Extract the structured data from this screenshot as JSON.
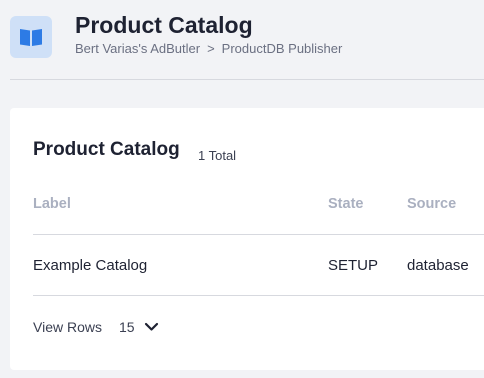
{
  "header": {
    "title": "Product Catalog",
    "breadcrumb": [
      "Bert Varias's AdButler",
      "ProductDB Publisher"
    ],
    "separator": ">",
    "icon": "book-icon"
  },
  "catalog": {
    "title": "Product Catalog",
    "total": "1 Total",
    "columns": [
      "Label",
      "State",
      "Source"
    ],
    "rows": [
      {
        "label": "Example Catalog",
        "state": "SETUP",
        "source": "database"
      }
    ],
    "pagination": {
      "view_rows_label": "View Rows",
      "rows_per_page": "15"
    }
  },
  "colors": {
    "accent": "#2d7be5",
    "icon_bg": "#cfe0f7",
    "page_bg": "#f2f3f6"
  }
}
